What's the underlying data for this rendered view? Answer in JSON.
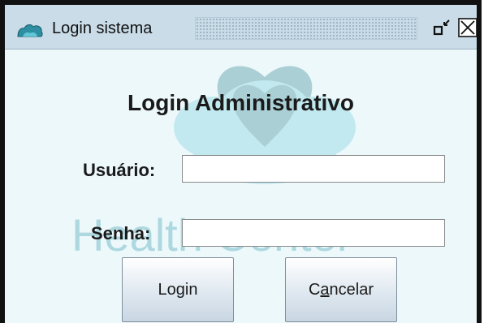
{
  "window": {
    "title": "Login sistema",
    "icons": {
      "app": "app-logo-icon",
      "restore": "restore-icon",
      "close": "close-icon"
    }
  },
  "form": {
    "heading": "Login Administrativo",
    "user_label": "Usuário:",
    "user_value": "",
    "pass_label": "Senha:",
    "pass_value": ""
  },
  "buttons": {
    "login": {
      "pre": "Lo",
      "mnemonic": "g",
      "post": "in"
    },
    "cancel": {
      "pre": "C",
      "mnemonic": "a",
      "post": "ncelar"
    }
  },
  "watermark": {
    "text": "Health Center"
  },
  "colors": {
    "titlebar": "#c9dce8",
    "background": "#edf8fb",
    "logo": "#2e8fa3"
  }
}
